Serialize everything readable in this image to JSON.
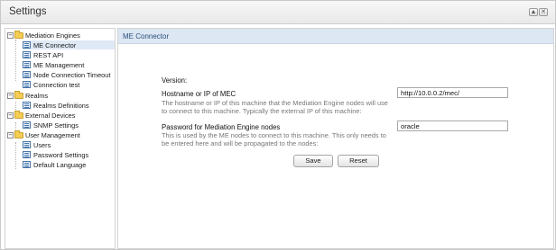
{
  "window": {
    "title": "Settings",
    "buttons": [
      "▲",
      "✕"
    ]
  },
  "sidebar": {
    "groups": [
      {
        "label": "Mediation Engines",
        "expanded": true,
        "items": [
          "ME Connector",
          "REST API",
          "ME Management",
          "Node Connection Timeout",
          "Connection test"
        ]
      },
      {
        "label": "Realms",
        "expanded": true,
        "items": [
          "Realms Definitions"
        ]
      },
      {
        "label": "External Devices",
        "expanded": true,
        "items": [
          "SNMP Settings"
        ]
      },
      {
        "label": "User Management",
        "expanded": true,
        "items": [
          "Users",
          "Password Settings",
          "Default Language"
        ]
      }
    ],
    "selected": "ME Connector",
    "toggle_symbol": "−"
  },
  "panel": {
    "title": "ME Connector",
    "version_label": "Version:",
    "hostname": {
      "label": "Hostname or IP of MEC",
      "help": "The hostname or IP of this machine that the Mediation Engine nodes will use to connect to this machine. Typically the external IP of this machine:",
      "value": "http://10.0.0.2/mec/"
    },
    "password": {
      "label": "Password for Mediation Engine nodes",
      "help": "This is used by the ME nodes to connect to this machine. This only needs to be entered here and will be propagated to the nodes:",
      "value": "oracle"
    },
    "save_label": "Save",
    "reset_label": "Reset"
  }
}
